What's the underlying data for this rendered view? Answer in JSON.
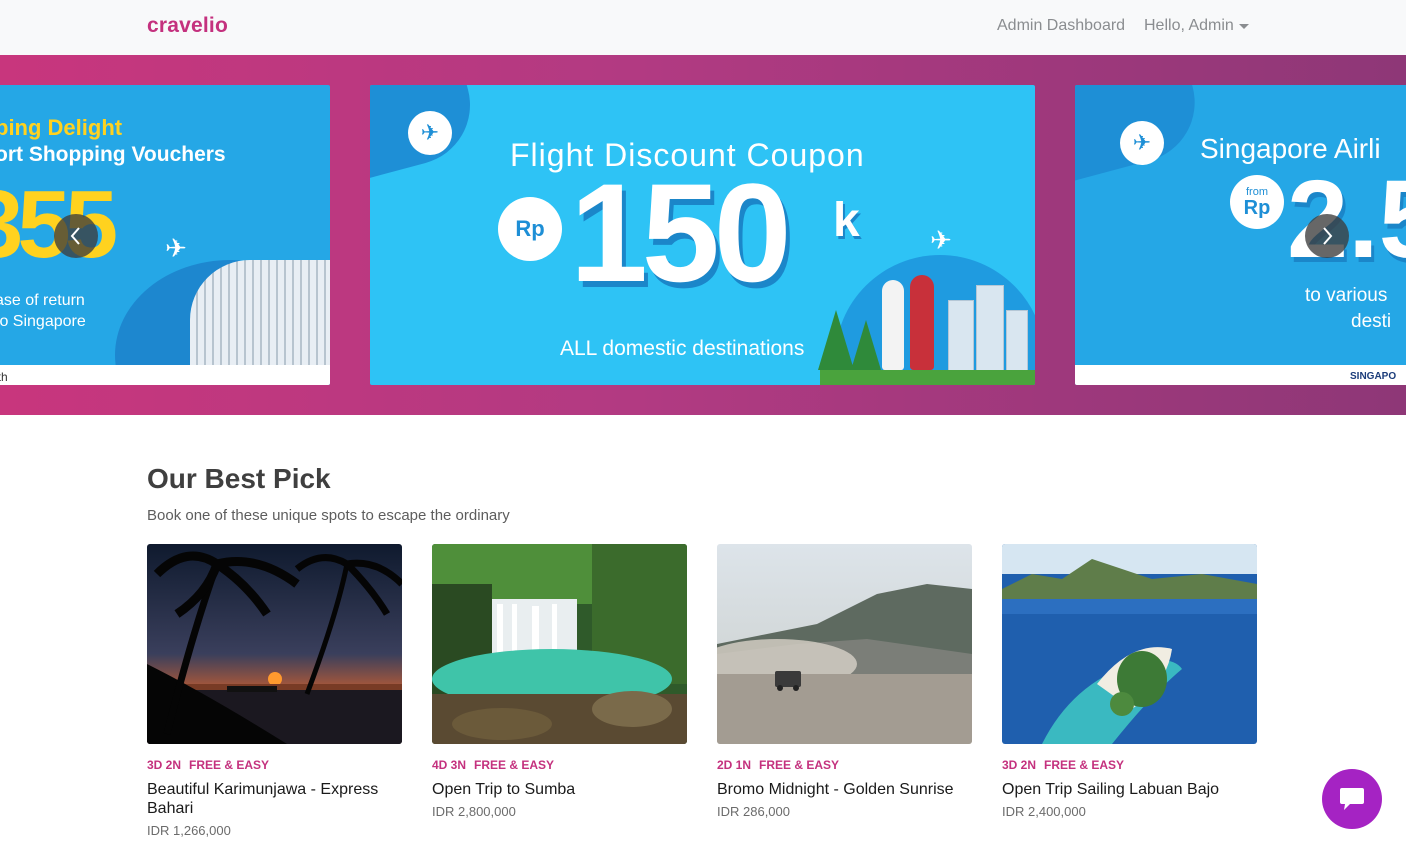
{
  "nav": {
    "brand": "cravelio",
    "admin_dashboard": "Admin Dashboard",
    "hello": "Hello, Admin"
  },
  "hero": {
    "left_slide": {
      "line1": "ping Delight",
      "line2": "ort Shopping Vouchers",
      "big": "355",
      "line3": "ase of return",
      "line4": "to Singapore",
      "footer": "ith"
    },
    "center_slide": {
      "title": "Flight Discount Coupon",
      "currency": "Rp",
      "amount": "150",
      "suffix": "k",
      "subtitle": "ALL domestic destinations"
    },
    "right_slide": {
      "title": "Singapore Airli",
      "from": "from",
      "currency": "Rp",
      "big": "2.5",
      "sub1": "to various",
      "sub2": "desti",
      "footer": "SINGAPO"
    }
  },
  "section": {
    "title": "Our Best Pick",
    "subtitle": "Book one of these unique spots to escape the ordinary"
  },
  "cards": [
    {
      "duration": "3D 2N",
      "type": "FREE & EASY",
      "title": "Beautiful Karimunjawa - Express Bahari",
      "price": "IDR 1,266,000"
    },
    {
      "duration": "4D 3N",
      "type": "FREE & EASY",
      "title": "Open Trip to Sumba",
      "price": "IDR 2,800,000"
    },
    {
      "duration": "2D 1N",
      "type": "FREE & EASY",
      "title": "Bromo Midnight - Golden Sunrise",
      "price": "IDR 286,000"
    },
    {
      "duration": "3D 2N",
      "type": "FREE & EASY",
      "title": "Open Trip Sailing Labuan Bajo",
      "price": "IDR 2,400,000"
    }
  ],
  "colors": {
    "brand": "#c4317e",
    "hero_gradient_start": "#c8367d",
    "hero_gradient_end": "#8e3777",
    "chat": "#a523c3"
  }
}
